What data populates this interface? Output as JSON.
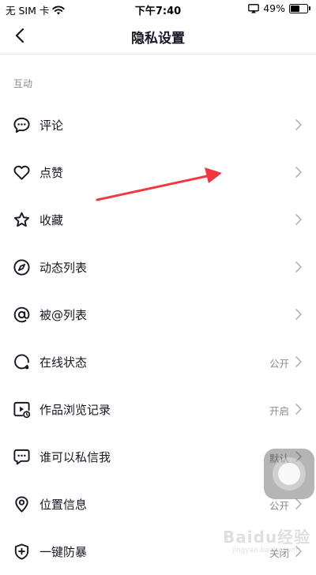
{
  "status_bar": {
    "carrier": "无 SIM 卡",
    "time": "下午7:40",
    "battery_percent": "49%",
    "battery_level": 0.49
  },
  "header": {
    "title": "隐私设置"
  },
  "section": {
    "label": "互动"
  },
  "rows": [
    {
      "label": "评论",
      "value": "",
      "icon": "comment-icon"
    },
    {
      "label": "点赞",
      "value": "",
      "icon": "heart-icon"
    },
    {
      "label": "收藏",
      "value": "",
      "icon": "star-icon"
    },
    {
      "label": "动态列表",
      "value": "",
      "icon": "compass-icon"
    },
    {
      "label": "被@列表",
      "value": "",
      "icon": "at-icon"
    },
    {
      "label": "在线状态",
      "value": "公开",
      "icon": "online-status-icon"
    },
    {
      "label": "作品浏览记录",
      "value": "开启",
      "icon": "video-history-icon"
    },
    {
      "label": "谁可以私信我",
      "value": "默认",
      "icon": "message-icon"
    },
    {
      "label": "位置信息",
      "value": "公开",
      "icon": "location-icon"
    },
    {
      "label": "一键防暴",
      "value": "关闭",
      "icon": "shield-plus-icon"
    }
  ],
  "annotation": {
    "color": "#f2373f"
  },
  "watermark": {
    "main": "Baidu经验",
    "sub": "jingyan.baidu.com"
  }
}
